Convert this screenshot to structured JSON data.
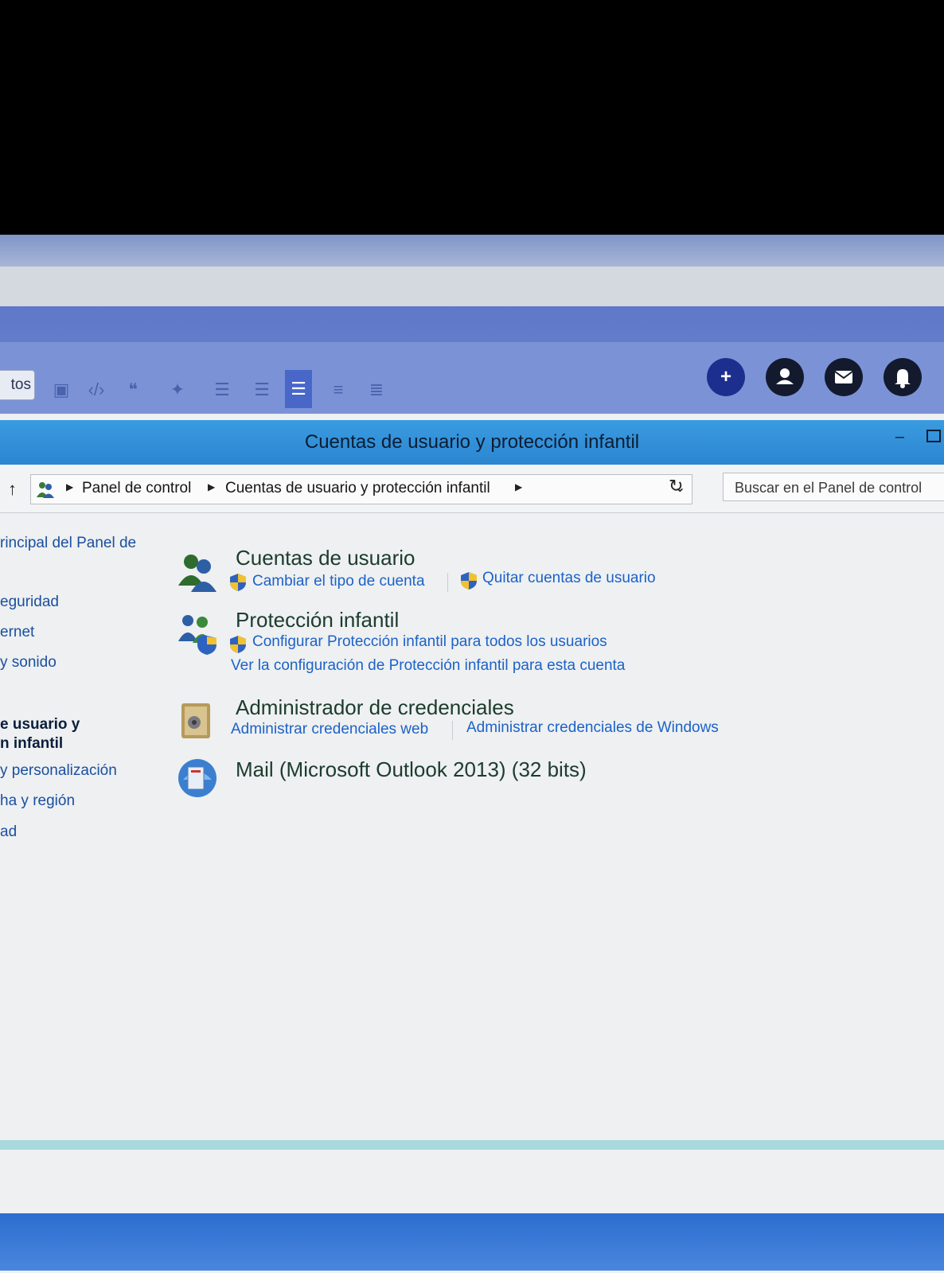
{
  "editor": {
    "tab_label": "tos",
    "toolbar_buttons": [
      "image-icon",
      "code-icon",
      "quote-icon",
      "twitter-icon",
      "list-icon",
      "indent-icon",
      "align-left-icon",
      "align-center-icon",
      "align-justify-icon"
    ],
    "action_buttons": {
      "add": "+",
      "user": "●",
      "mail": "✉",
      "bell": "🔔"
    }
  },
  "window": {
    "title": "Cuentas de usuario y protección infantil",
    "minimize": "–"
  },
  "address": {
    "crumbs": [
      "Panel de control",
      "Cuentas de usuario y protección infantil"
    ],
    "search_placeholder": "Buscar en el Panel de control"
  },
  "nav": {
    "items": [
      "rincipal del Panel de",
      "eguridad",
      "ernet",
      "y sonido",
      "e usuario y",
      "n infantil",
      "y personalización",
      "ha y región",
      "ad"
    ]
  },
  "sections": {
    "accounts": {
      "title": "Cuentas de usuario",
      "links": [
        "Cambiar el tipo de cuenta",
        "Quitar cuentas de usuario"
      ]
    },
    "family": {
      "title": "Protección infantil",
      "links": [
        "Configurar Protección infantil para todos los usuarios",
        "Ver la configuración de Protección infantil para esta cuenta"
      ]
    },
    "credentials": {
      "title": "Administrador de credenciales",
      "links": [
        "Administrar credenciales web",
        "Administrar credenciales de Windows"
      ]
    },
    "mail": {
      "title": "Mail (Microsoft Outlook 2013) (32 bits)"
    }
  },
  "colors": {
    "titlebar": "#2b86d0",
    "link": "#1c62c8",
    "editor_bar": "#6f88d2"
  }
}
